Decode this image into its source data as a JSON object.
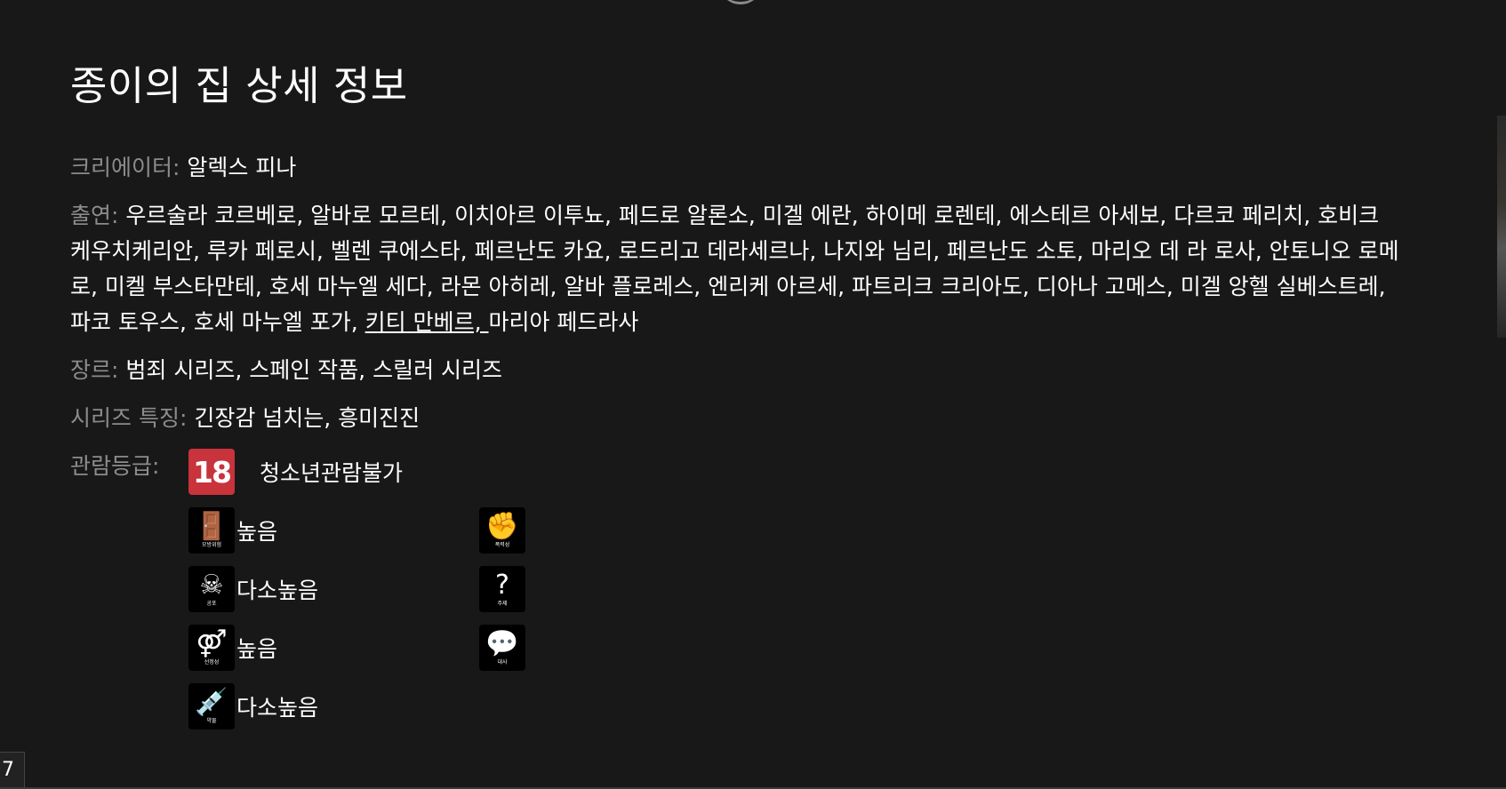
{
  "title": "종이의 집 상세 정보",
  "creator": {
    "label": "크리에이터:",
    "value": "알렉스 피나"
  },
  "cast": {
    "label": "출연:",
    "text_before": "우르술라 코르베로, 알바로 모르테, 이치아르 이투뇨, 페드로 알론소, 미겔 에란, 하이메 로렌테, 에스테르 아세보, 다르코 페리치, 호비크 케우치케리안, 루카 페로시, 벨렌 쿠에스타, 페르난도 카요, 로드리고 데라세르나, 나지와 님리, 페르난도 소토, 마리오 데 라 로사, 안토니오 로메로, 미켈 부스타만테, 호세 마누엘 세다, 라몬 아히레, 알바 플로레스, 엔리케 아르세, 파트리크 크리아도, 디아나 고메스, 미겔 앙헬 실베스트레, 파코 토우스, 호세 마누엘 포가, ",
    "link": "키티 만베르, ",
    "text_after": "마리아 페드라사"
  },
  "genre": {
    "label": "장르:",
    "value": "범죄 시리즈, 스페인 작품, 스릴러 시리즈"
  },
  "features": {
    "label": "시리즈 특징:",
    "value": "긴장감 넘치는, 흥미진진"
  },
  "rating": {
    "label": "관람등급:",
    "age_icon": "18",
    "age_text": "청소년관람불가",
    "age_color": "#c8333c",
    "descriptors": [
      {
        "icon": "imitation-risk-icon",
        "glyph": "🚪",
        "caption": "모방위험",
        "level": "높음"
      },
      {
        "icon": "violence-icon",
        "glyph": "✊",
        "caption": "폭력성",
        "level": ""
      },
      {
        "icon": "fear-icon",
        "glyph": "☠",
        "caption": "공포",
        "level": "다소높음"
      },
      {
        "icon": "theme-icon",
        "glyph": "?",
        "caption": "주제",
        "level": ""
      },
      {
        "icon": "sexuality-icon",
        "glyph": "⚤",
        "caption": "선정성",
        "level": "높음"
      },
      {
        "icon": "dialogue-icon",
        "glyph": "💬",
        "caption": "대사",
        "level": ""
      },
      {
        "icon": "drug-icon",
        "glyph": "💉",
        "caption": "약물",
        "level": "다소높음"
      }
    ]
  },
  "bottom_badge": "7"
}
